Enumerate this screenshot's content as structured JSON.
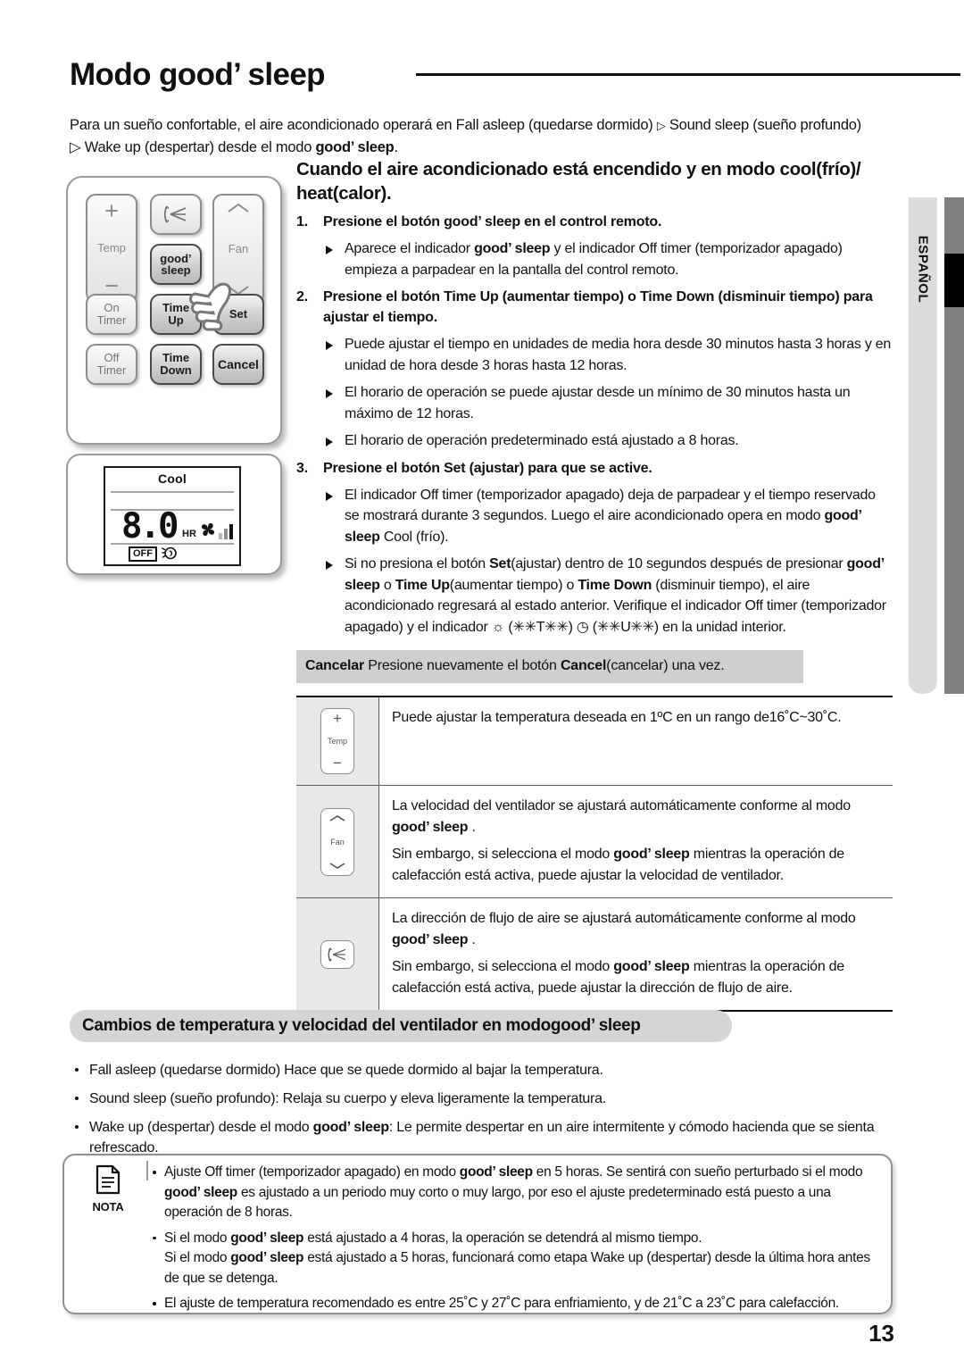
{
  "header": {
    "title_prefix": "Modo ",
    "title_brand": "good’ sleep"
  },
  "intro": {
    "line1_a": "Para un sueño confortable, el aire acondicionado operará en Fall asleep (quedarse dormido) ",
    "arrow": "▷",
    "line1_b": " Sound sleep (sueño profundo)",
    "line2_a": "▷ Wake up (despertar) desde el modo ",
    "line2_brand": "good’ sleep",
    "line2_b": "."
  },
  "language_tab": {
    "label": "ESPAÑOL"
  },
  "remote": {
    "buttons": {
      "temp_plus": "+",
      "temp_label": "Temp",
      "temp_minus": "−",
      "airflow_icon": "airflow-direction-icon",
      "fan_label": "Fan",
      "good_sleep_line1": "good’",
      "good_sleep_line2": "sleep",
      "on_timer_line1": "On",
      "on_timer_line2": "Timer",
      "time_up_line1": "Time",
      "time_up_line2": "Up",
      "set": "Set",
      "off_timer_line1": "Off",
      "off_timer_line2": "Timer",
      "time_down_line1": "Time",
      "time_down_line2": "Down",
      "cancel": "Cancel"
    },
    "hand_pointer": "hand-pointer-icon"
  },
  "lcd": {
    "mode": "Cool",
    "value": "8.0",
    "unit": "HR",
    "off_badge": "OFF",
    "fan_icon": "fan-blade-icon",
    "signal_icon": "fan-speed-bars-icon",
    "sleep_icon": "good-sleep-indicator-icon"
  },
  "main": {
    "section_heading": "Cuando el aire acondicionado está encendido y en modo cool(frío)/ heat(calor).",
    "steps": [
      {
        "num": "1.",
        "text_a": "Presione el botón ",
        "brand": "good’ sleep",
        "text_b": " en el control remoto.",
        "bullets": [
          "Aparece el indicador |good’ sleep| y el indicador Off timer (temporizador apagado) empieza a parpadear en la pantalla del control remoto."
        ]
      },
      {
        "num": "2.",
        "text_a": "Presione el botón Time Up (aumentar tiempo) o Time Down (disminuir tiempo) para ajustar el tiempo.",
        "brand": "",
        "text_b": "",
        "bullets": [
          "Puede ajustar el tiempo en unidades de media hora desde 30 minutos hasta 3 horas y en unidad de hora desde 3 horas hasta 12 horas.",
          "El horario de operación se puede ajustar desde un mínimo de 30 minutos hasta un máximo de 12 horas.",
          "El horario de operación predeterminado está ajustado a 8 horas."
        ]
      },
      {
        "num": "3.",
        "text_a": "Presione el botón Set (ajustar) para que se active.",
        "brand": "",
        "text_b": "",
        "bullets": [
          "El indicador Off timer (temporizador apagado) deja de parpadear y el tiempo reservado se mostrará durante 3 segundos. Luego el aire acondicionado opera en modo |good’ sleep| Cool (frío).",
          "Si no presiona el botón |Set|(ajustar) dentro de 10 segundos después de presionar |good’ sleep| o |Time Up|(aumentar tiempo) o |Time Down| (disminuir tiempo), el aire acondicionado regresará al estado anterior. Verifique el indicador Off timer (temporizador apagado) y el indicador ☼ (✳✳T✳✳) ◷ (✳✳U✳✳) en la unidad interior."
        ]
      }
    ],
    "cancel_bar": {
      "label": "Cancelar",
      "text_a": " Presione nuevamente el botón ",
      "bold": "Cancel",
      "text_b": "(cancelar) una vez."
    }
  },
  "feature_table": [
    {
      "icon": "temp-updown-icon",
      "icon_labels": {
        "plus": "+",
        "label": "Temp",
        "minus": "−"
      },
      "paragraphs": [
        "Puede ajustar la temperatura deseada en 1ºC en un rango de16˚C~30˚C."
      ]
    },
    {
      "icon": "fan-updown-icon",
      "icon_labels": {
        "label": "Fan"
      },
      "paragraphs": [
        "La velocidad del ventilador se ajustará automáticamente conforme al modo |good’ sleep| .",
        "Sin embargo, si selecciona el modo |good’ sleep| mientras la operación de calefacción está activa, puede ajustar la velocidad de ventilador."
      ]
    },
    {
      "icon": "airflow-direction-icon",
      "icon_labels": {},
      "paragraphs": [
        "La dirección de flujo de aire se ajustará automáticamente conforme al modo |good’ sleep| .",
        "Sin embargo, si selecciona el modo |good’ sleep| mientras la operación de calefacción está activa, puede ajustar la dirección de flujo de aire."
      ]
    }
  ],
  "banner": {
    "text_a": "Cambios de temperatura y velocidad del ventilador en modo ",
    "brand": "good’ sleep"
  },
  "banner_bullets": [
    "Fall asleep (quedarse dormido) Hace que se quede dormido al bajar la temperatura.",
    "Sound sleep (sueño profundo): Relaja su cuerpo y eleva ligeramente la temperatura.",
    "Wake up (despertar) desde el modo |good’ sleep|: Le permite despertar en un aire intermitente y cómodo hacienda que se sienta refrescado."
  ],
  "note": {
    "label": "NOTA",
    "items": [
      "Ajuste Off timer (temporizador apagado) en modo |good’ sleep| en 5 horas. Se sentirá con sueño perturbado si el modo |good’ sleep| es ajustado a un periodo muy corto o muy largo, por eso el ajuste predeterminado está puesto a una operación de 8 horas.",
      "Si el modo |good’ sleep| está ajustado a 4 horas, la operación se detendrá al mismo tiempo.\nSi el modo |good’ sleep| está ajustado a 5 horas, funcionará como etapa Wake up (despertar) desde la última hora antes de que se detenga.",
      "El ajuste de temperatura recomendado es entre 25˚C y 27˚C para enfriamiento, y de 21˚C a 23˚C para calefacción."
    ]
  },
  "page_number": "13"
}
